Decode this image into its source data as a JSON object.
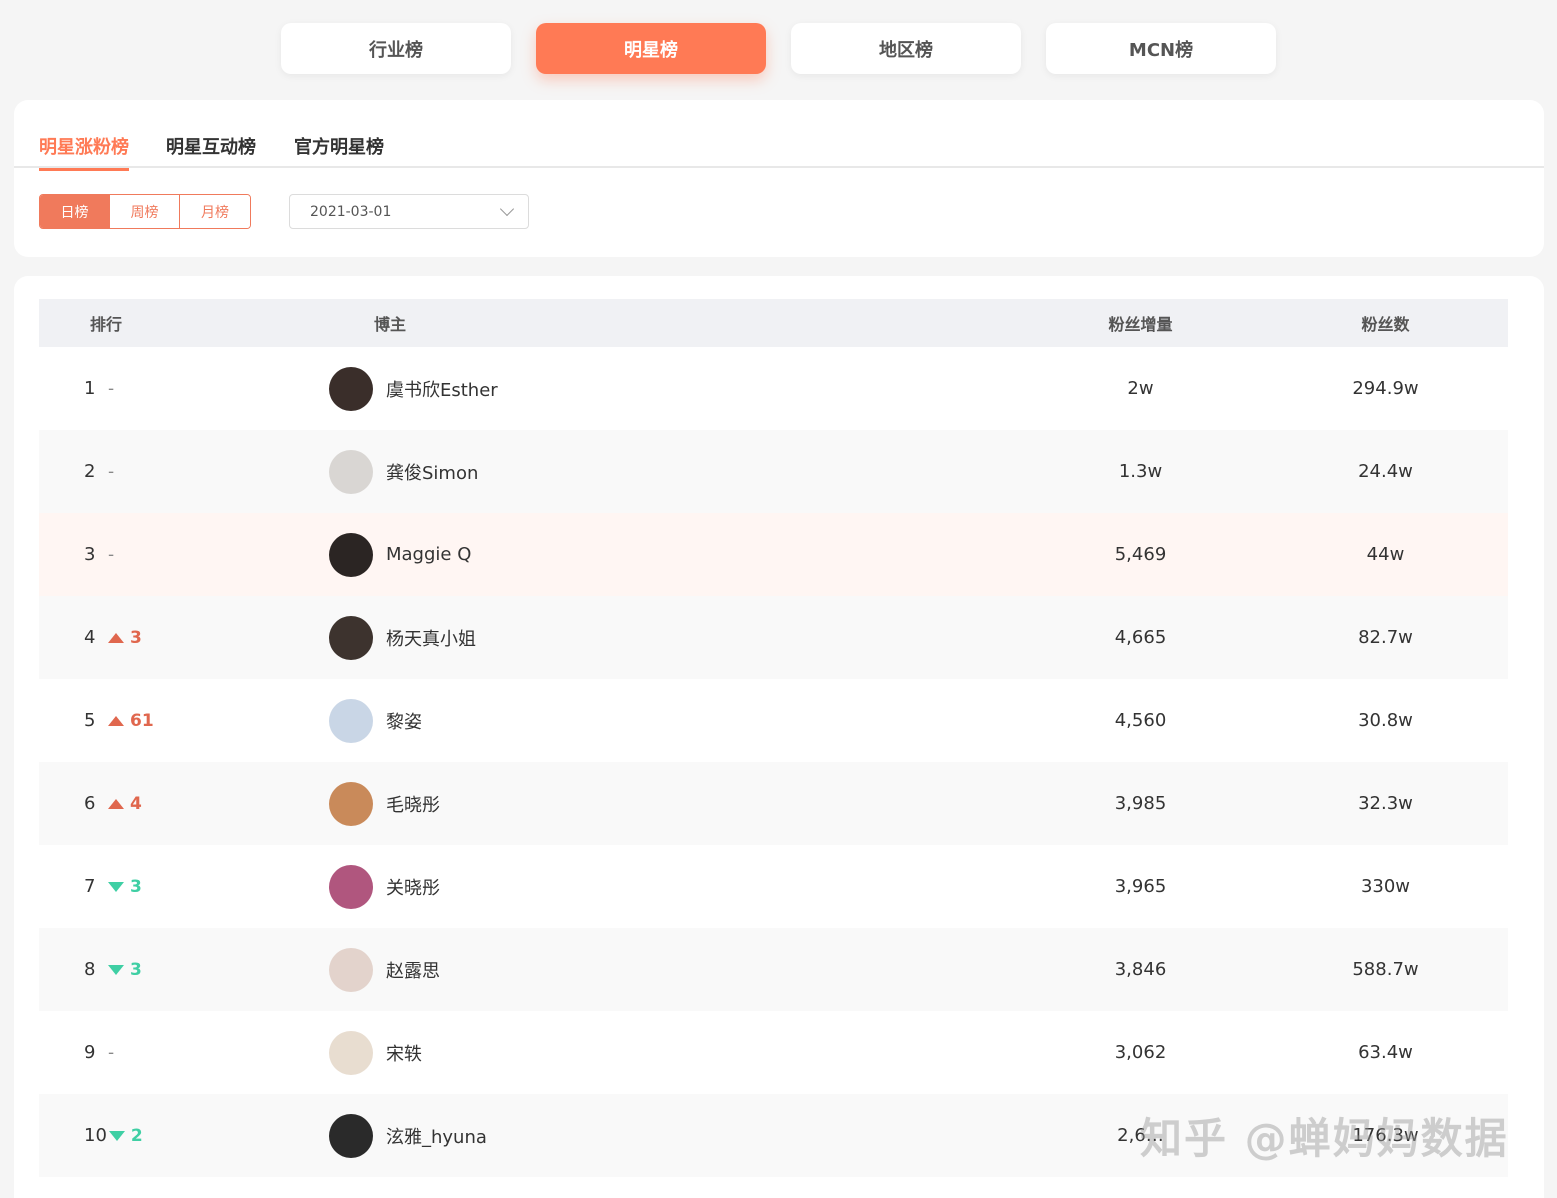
{
  "top_tabs": [
    {
      "label": "行业榜",
      "active": false
    },
    {
      "label": "明星榜",
      "active": true
    },
    {
      "label": "地区榜",
      "active": false
    },
    {
      "label": "MCN榜",
      "active": false
    }
  ],
  "sub_tabs": [
    {
      "label": "明星涨粉榜",
      "active": true
    },
    {
      "label": "明星互动榜",
      "active": false
    },
    {
      "label": "官方明星榜",
      "active": false
    }
  ],
  "period": {
    "options": [
      "日榜",
      "周榜",
      "月榜"
    ],
    "selected": "日榜"
  },
  "date_select": {
    "value": "2021-03-01",
    "icon": "chevron-down-icon"
  },
  "table": {
    "headers": {
      "rank": "排行",
      "blogger": "博主",
      "increase": "粉丝增量",
      "fans": "粉丝数"
    },
    "rows": [
      {
        "rank": "1",
        "change_dir": "none",
        "change": "-",
        "name": "虞书欣Esther",
        "increase": "2w",
        "fans": "294.9w",
        "avatar_color": "#3a2e2a"
      },
      {
        "rank": "2",
        "change_dir": "none",
        "change": "-",
        "name": "龚俊Simon",
        "increase": "1.3w",
        "fans": "24.4w",
        "avatar_color": "#d9d6d3"
      },
      {
        "rank": "3",
        "change_dir": "none",
        "change": "-",
        "name": "Maggie Q",
        "increase": "5,469",
        "fans": "44w",
        "avatar_color": "#2b2523"
      },
      {
        "rank": "4",
        "change_dir": "up",
        "change": "3",
        "name": "杨天真小姐",
        "increase": "4,665",
        "fans": "82.7w",
        "avatar_color": "#3d332e"
      },
      {
        "rank": "5",
        "change_dir": "up",
        "change": "61",
        "name": "黎姿",
        "increase": "4,560",
        "fans": "30.8w",
        "avatar_color": "#c9d6e6"
      },
      {
        "rank": "6",
        "change_dir": "up",
        "change": "4",
        "name": "毛晓彤",
        "increase": "3,985",
        "fans": "32.3w",
        "avatar_color": "#c98a5a"
      },
      {
        "rank": "7",
        "change_dir": "down",
        "change": "3",
        "name": "关晓彤",
        "increase": "3,965",
        "fans": "330w",
        "avatar_color": "#b0567e"
      },
      {
        "rank": "8",
        "change_dir": "down",
        "change": "3",
        "name": "赵露思",
        "increase": "3,846",
        "fans": "588.7w",
        "avatar_color": "#e3d3cc"
      },
      {
        "rank": "9",
        "change_dir": "none",
        "change": "-",
        "name": "宋轶",
        "increase": "3,062",
        "fans": "63.4w",
        "avatar_color": "#e8ddd0"
      },
      {
        "rank": "10",
        "change_dir": "down",
        "change": "2",
        "name": "泫雅_hyuna",
        "increase": "2,6…",
        "fans": "176.3w",
        "avatar_color": "#2a2a2a"
      }
    ]
  },
  "watermark": "知乎 @蝉妈妈数据",
  "colors": {
    "accent": "#ff7a55",
    "up": "#e0674e",
    "down": "#3fcfa4"
  }
}
